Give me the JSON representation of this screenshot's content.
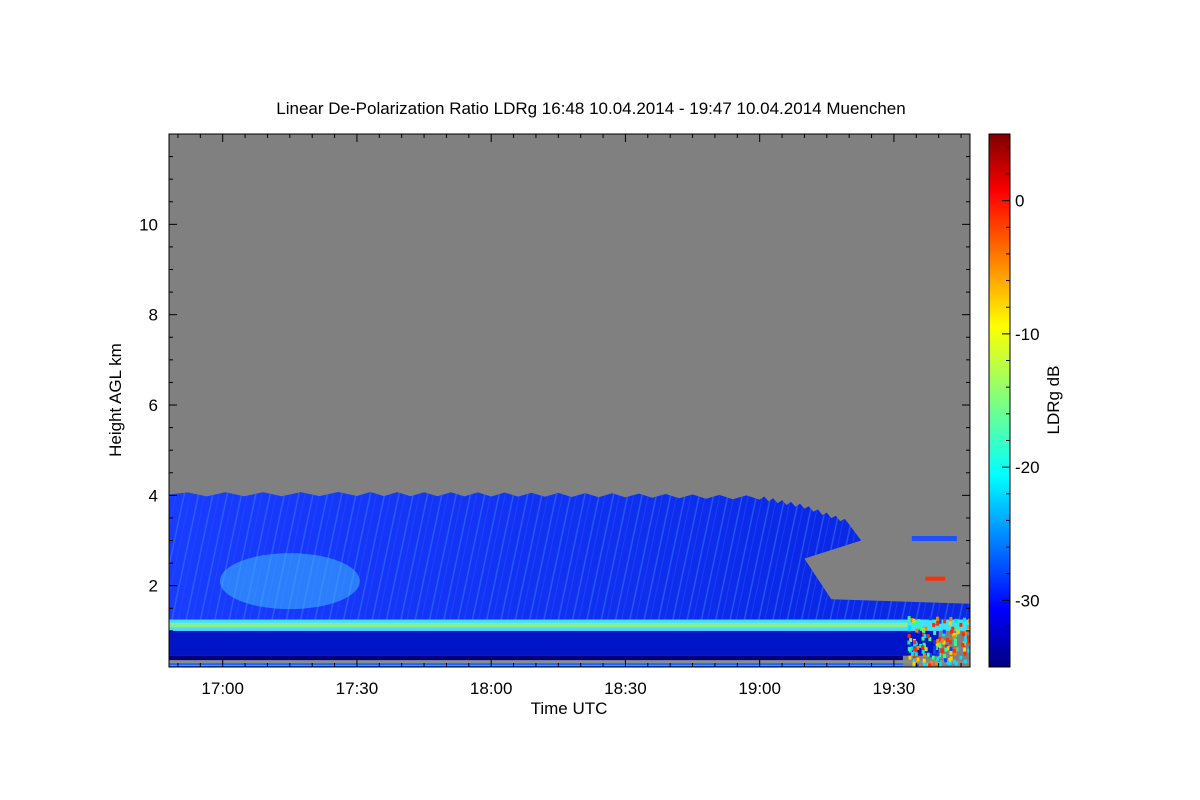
{
  "chart_data": {
    "type": "heatmap",
    "title": "Linear De-Polarization Ratio LDRg   16:48 10.04.2014 - 19:47 10.04.2014 Muenchen",
    "xlabel": "Time UTC",
    "ylabel": "Height AGL km",
    "xlim": [
      "16:48",
      "19:47"
    ],
    "ylim": [
      0.2,
      12
    ],
    "x_ticks": [
      "17:00",
      "17:30",
      "18:00",
      "18:30",
      "19:00",
      "19:30"
    ],
    "y_ticks": [
      2,
      4,
      6,
      8,
      10
    ],
    "colorbar": {
      "label": "LDRg dB",
      "range": [
        -35,
        5
      ],
      "ticks": [
        0,
        -10,
        -20,
        -30
      ],
      "colormap": "jet"
    },
    "no_data_color": "#808080",
    "layers": [
      {
        "name_visible": false,
        "time_range": [
          "16:48",
          "19:47"
        ],
        "height_km": [
          1.0,
          1.25
        ],
        "ldr_db": -22
      },
      {
        "name_visible": false,
        "time_range": [
          "16:48",
          "19:22"
        ],
        "height_km": [
          1.25,
          4.0
        ],
        "ldr_db": -31
      },
      {
        "name_visible": false,
        "time_range": [
          "17:05",
          "17:25"
        ],
        "height_km": [
          1.6,
          2.6
        ],
        "ldr_db": -24
      }
    ],
    "aerosol_top_km": [
      {
        "time": "16:48",
        "height": 4.02
      },
      {
        "time": "17:30",
        "height": 4.03
      },
      {
        "time": "18:00",
        "height": 4.02
      },
      {
        "time": "18:30",
        "height": 4.0
      },
      {
        "time": "19:00",
        "height": 3.95
      },
      {
        "time": "19:10",
        "height": 3.75
      },
      {
        "time": "19:20",
        "height": 3.4
      }
    ]
  }
}
